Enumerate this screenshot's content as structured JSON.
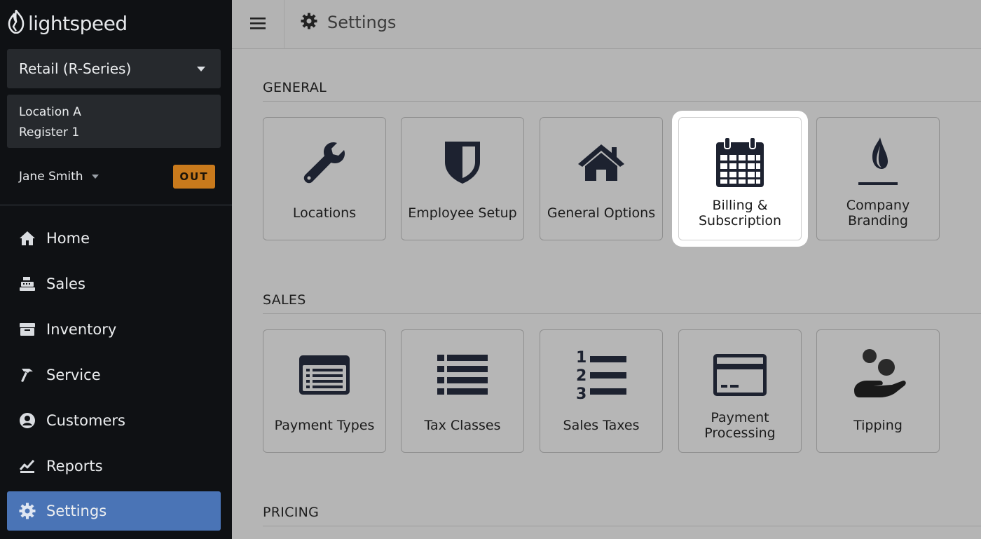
{
  "brand": {
    "logo_text": "lightspeed"
  },
  "sidebar": {
    "product_select": {
      "value": "Retail (R-Series)"
    },
    "register": {
      "location": "Location A",
      "register": "Register 1"
    },
    "user": {
      "name": "Jane Smith",
      "status_badge": "OUT",
      "badge_color": "#c97a1c"
    },
    "nav": [
      {
        "label": "Home",
        "icon": "home-icon",
        "active": false
      },
      {
        "label": "Sales",
        "icon": "cash-register-icon",
        "active": false
      },
      {
        "label": "Inventory",
        "icon": "archive-box-icon",
        "active": false
      },
      {
        "label": "Service",
        "icon": "hammer-icon",
        "active": false
      },
      {
        "label": "Customers",
        "icon": "user-circle-icon",
        "active": false
      },
      {
        "label": "Reports",
        "icon": "chart-line-icon",
        "active": false
      },
      {
        "label": "Settings",
        "icon": "gear-icon",
        "active": true
      }
    ],
    "active_color": "#4a74b6"
  },
  "topbar": {
    "title": "Settings",
    "icon": "gear-icon",
    "menu_icon": "hamburger-icon"
  },
  "sections": {
    "general": {
      "title": "GENERAL",
      "tiles": [
        {
          "label": "Locations",
          "icon": "wrench-icon"
        },
        {
          "label": "Employee Setup",
          "icon": "shield-icon"
        },
        {
          "label": "General Options",
          "icon": "house-icon"
        },
        {
          "label": "Billing & Subscription",
          "line1": "Billing &",
          "line2": "Subscription",
          "icon": "calendar-icon",
          "highlighted": true
        },
        {
          "label": "Company Branding",
          "line1": "Company",
          "line2": "Branding",
          "icon": "flame-icon"
        }
      ]
    },
    "sales": {
      "title": "SALES",
      "tiles": [
        {
          "label": "Payment Types",
          "icon": "list-card-icon"
        },
        {
          "label": "Tax Classes",
          "icon": "list-icon"
        },
        {
          "label": "Sales Taxes",
          "icon": "numbered-list-icon"
        },
        {
          "label": "Payment Processing",
          "line1": "Payment",
          "line2": "Processing",
          "icon": "credit-card-icon"
        },
        {
          "label": "Tipping",
          "icon": "hand-coins-icon"
        }
      ]
    },
    "pricing": {
      "title": "PRICING"
    }
  }
}
